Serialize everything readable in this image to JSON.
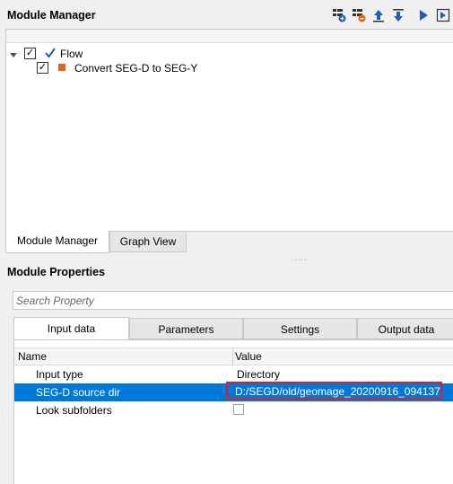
{
  "module_manager": {
    "title": "Module Manager",
    "toolbar": [
      "add-module-icon",
      "remove-module-icon",
      "move-up-icon",
      "move-down-icon",
      "run-icon",
      "run-step-icon"
    ],
    "tree": {
      "root": {
        "label": "Flow",
        "checked": true
      },
      "children": [
        {
          "label": "Convert SEG-D to SEG-Y",
          "checked": true
        }
      ]
    },
    "tabs": [
      "Module Manager",
      "Graph View"
    ]
  },
  "module_properties": {
    "title": "Module Properties",
    "search_placeholder": "Search Property",
    "tabs": [
      "Input data",
      "Parameters",
      "Settings",
      "Output data"
    ],
    "columns": {
      "name": "Name",
      "value": "Value"
    },
    "rows": [
      {
        "name": "Input type",
        "value": "Directory"
      },
      {
        "name": "SEG-D source dir",
        "value": "D:/SEGD/old/geomage_20200916_094137"
      },
      {
        "name": "Look subfolders",
        "value": ""
      }
    ]
  },
  "colors": {
    "selection": "#0078d7",
    "highlight_border": "#e31b23",
    "accent_blue": "#1f5fb5",
    "orange": "#e0661f"
  }
}
